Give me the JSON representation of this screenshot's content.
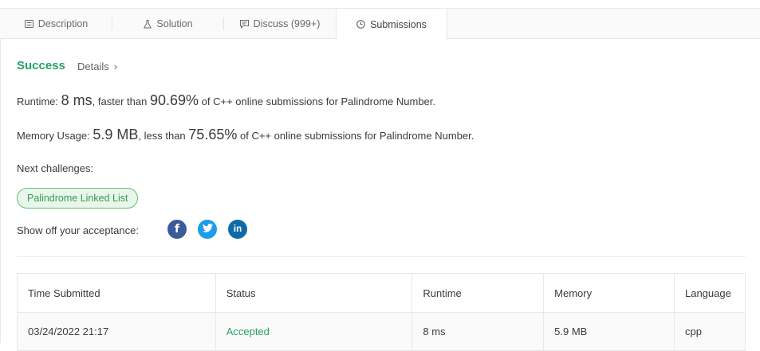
{
  "tabs": [
    {
      "label": "Description",
      "icon": "document-icon"
    },
    {
      "label": "Solution",
      "icon": "flask-icon"
    },
    {
      "label": "Discuss (999+)",
      "icon": "comment-icon"
    },
    {
      "label": "Submissions",
      "icon": "clock-icon"
    }
  ],
  "result": {
    "status": "Success",
    "details_label": "Details",
    "runtime": {
      "label": "Runtime:",
      "value": "8 ms",
      "mid": ", faster than",
      "percent": "90.69%",
      "suffix": "of C++ online submissions for Palindrome Number."
    },
    "memory": {
      "label": "Memory Usage:",
      "value": "5.9 MB",
      "mid": ", less than",
      "percent": "75.65%",
      "suffix": "of C++ online submissions for Palindrome Number."
    },
    "next_challenges_label": "Next challenges:",
    "next_challenge": "Palindrome Linked List",
    "share_label": "Show off your acceptance:"
  },
  "colors": {
    "success": "#26a169",
    "facebook": "#3b5a99",
    "twitter": "#1c9ceb",
    "linkedin": "#0e6ba8"
  },
  "table": {
    "headers": [
      "Time Submitted",
      "Status",
      "Runtime",
      "Memory",
      "Language"
    ],
    "rows": [
      [
        "03/24/2022 21:17",
        "Accepted",
        "8 ms",
        "5.9 MB",
        "cpp"
      ]
    ]
  }
}
